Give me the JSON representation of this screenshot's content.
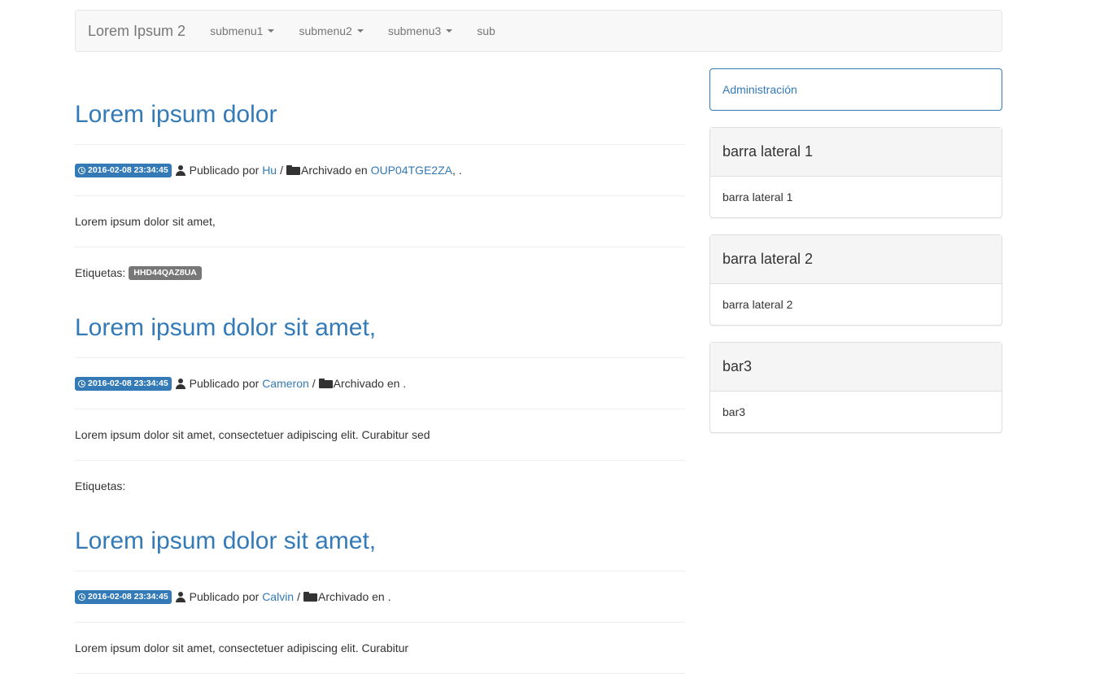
{
  "navbar": {
    "brand": "Lorem Ipsum 2",
    "items": [
      {
        "label": "submenu1",
        "dropdown": true
      },
      {
        "label": "submenu2",
        "dropdown": true
      },
      {
        "label": "submenu3",
        "dropdown": true
      },
      {
        "label": "sub",
        "dropdown": false
      }
    ]
  },
  "posts": [
    {
      "title": "Lorem ipsum dolor",
      "date": "2016-02-08 23:34:45",
      "published_by_label": "Publicado por",
      "author": "Hu",
      "filed_label": "Archivado en",
      "category": "OUP04TGE2ZA",
      "category_suffix": ", .",
      "body": "Lorem ipsum dolor sit amet,",
      "tags_label": "Etiquetas:",
      "tag": "HHD44QAZ8UA"
    },
    {
      "title": "Lorem ipsum dolor sit amet,",
      "date": "2016-02-08 23:34:45",
      "published_by_label": "Publicado por",
      "author": "Cameron",
      "filed_label": "Archivado en .",
      "body": "Lorem ipsum dolor sit amet, consectetuer adipiscing elit. Curabitur sed",
      "tags_label": "Etiquetas:"
    },
    {
      "title": "Lorem ipsum dolor sit amet,",
      "date": "2016-02-08 23:34:45",
      "published_by_label": "Publicado por",
      "author": "Calvin",
      "filed_label": "Archivado en .",
      "body": "Lorem ipsum dolor sit amet, consectetuer adipiscing elit. Curabitur"
    }
  ],
  "sidebar": {
    "admin_link": "Administración",
    "panels": [
      {
        "heading": "barra lateral 1",
        "body": "barra lateral 1"
      },
      {
        "heading": "barra lateral 2",
        "body": "barra lateral 2"
      },
      {
        "heading": "bar3",
        "body": "bar3"
      }
    ]
  },
  "colors": {
    "link": "#337ab7",
    "date_badge": "#337ab7",
    "tag_badge": "#777777",
    "navbar_bg": "#f8f8f8"
  }
}
